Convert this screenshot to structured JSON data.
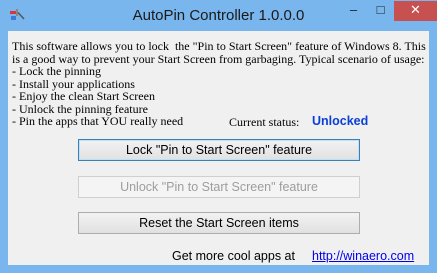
{
  "window": {
    "title": "AutoPin Controller 1.0.0.0",
    "controls": {
      "minimize": "–",
      "maximize": "□",
      "close": "✕"
    },
    "icon_name": "app-pin-icon"
  },
  "description": {
    "line1": "This software allows you to lock  the \"Pin to Start Screen\" feature of Windows 8. This",
    "line2": "is a good way to prevent your Start Screen from garbaging. Typical scenario of usage:",
    "bullets": [
      "- Lock the pinning",
      "- Install your applications",
      "- Enjoy the clean Start Screen",
      "- Unlock the pinning feature",
      "- Pin the apps that YOU really need"
    ]
  },
  "status": {
    "label": "Current status:",
    "value": "Unlocked",
    "value_color": "#0a3fd6"
  },
  "buttons": {
    "lock": "Lock \"Pin to Start Screen\" feature",
    "unlock": "Unlock \"Pin to Start Screen\" feature",
    "reset": "Reset the Start Screen items"
  },
  "footer": {
    "text": "Get more cool apps at",
    "link": "http://winaero.com"
  }
}
